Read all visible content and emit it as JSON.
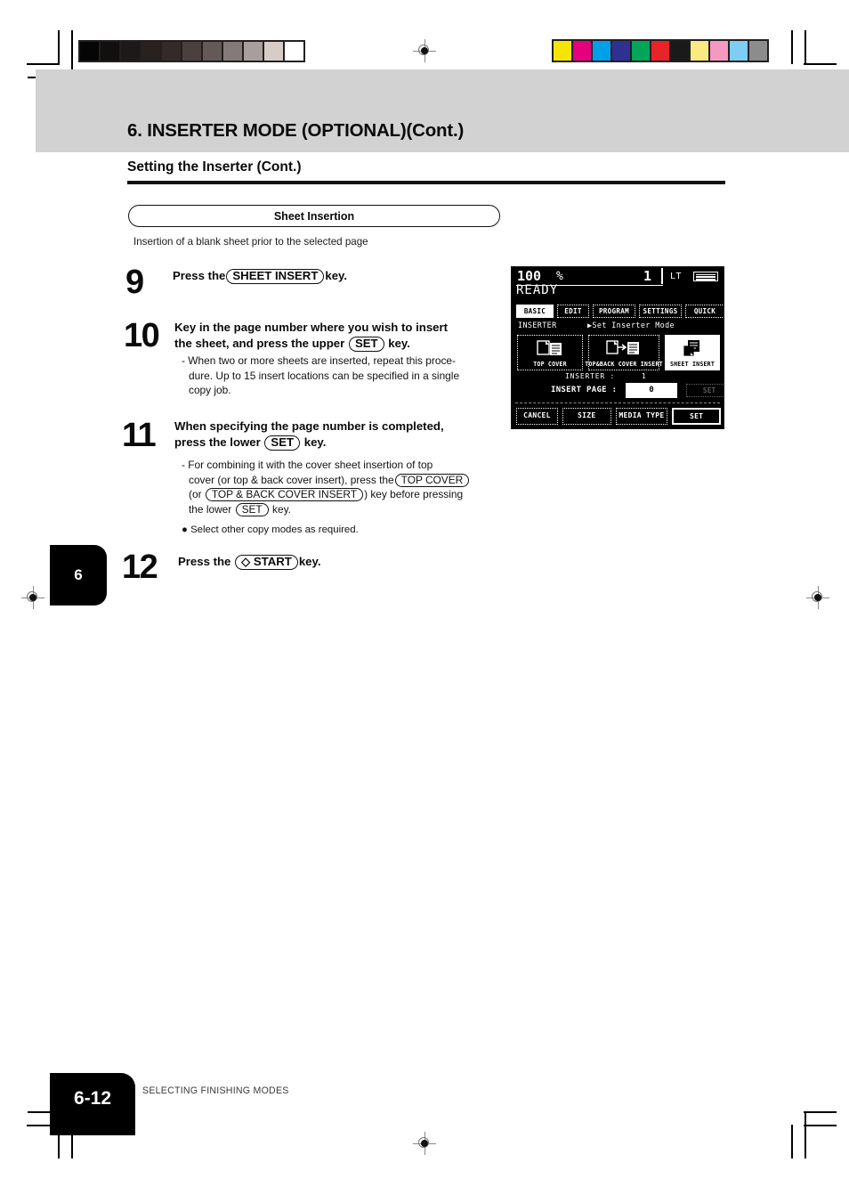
{
  "document": {
    "chapter_title": "6. INSERTER MODE (OPTIONAL)(Cont.)",
    "section_title": "Setting the Inserter (Cont.)",
    "pill_heading": "Sheet Insertion",
    "pill_subtext": "Insertion of a blank sheet prior to the selected page",
    "side_tab": "6",
    "folio": "6-12",
    "footer_text": "SELECTING FINISHING MODES"
  },
  "steps": [
    {
      "number": "9",
      "parts": [
        {
          "t": "text",
          "v": "Press the"
        },
        {
          "t": "key",
          "v": "SHEET INSERT"
        },
        {
          "t": "text",
          "v": "key."
        }
      ]
    },
    {
      "number": "10",
      "line1": "Key in the page number where you wish to insert",
      "line2_a": "the sheet, and press the upper",
      "key": "SET",
      "line2_b": "key.",
      "notes": [
        "- When two or more sheets are inserted, repeat  this proce-",
        "dure. Up to 15 insert locations can be specified in a single",
        "copy job."
      ]
    },
    {
      "number": "11",
      "line1": "When specifying the page number is completed,",
      "line2_a": "press the  lower",
      "key": "SET",
      "line2_b": "key.",
      "note_l1": "- For combining it with the cover sheet insertion of top",
      "note_l2_a": "cover (or top & back cover insert), press the",
      "note_key1": "TOP COVER",
      "note_l3_a": "(or",
      "note_key2": "TOP & BACK COVER INSERT",
      "note_l3_b": ") key before pressing",
      "note_l4_a": "the lower",
      "note_key3": "SET",
      "note_l4_b": "key.",
      "bullet": "Select other copy modes as required."
    },
    {
      "number": "12",
      "parts": [
        {
          "t": "text",
          "v": "Press the"
        },
        {
          "t": "key",
          "v": "◇ START"
        },
        {
          "t": "text",
          "v": "key."
        }
      ]
    }
  ],
  "lcd": {
    "zoom_ratio": "100",
    "percent_sign": "%",
    "copy_count": "1",
    "paper_size": "LT",
    "status": "READY",
    "tabs": [
      {
        "label": "BASIC",
        "active": true
      },
      {
        "label": "EDIT",
        "active": false
      },
      {
        "label": "PROGRAM",
        "active": false
      },
      {
        "label": "SETTINGS",
        "active": false
      },
      {
        "label": "QUICK",
        "active": false
      }
    ],
    "mode_label": "INSERTER",
    "mode_prompt": "▶Set Inserter Mode",
    "modes": [
      {
        "label": "TOP COVER",
        "selected": false
      },
      {
        "label": "TOP&BACK COVER INSERT",
        "selected": false
      },
      {
        "label": "SHEET INSERT",
        "selected": true
      }
    ],
    "inserter_row_label": "INSERTER  :",
    "inserter_row_value": "1",
    "insert_page_label": "INSERT PAGE  :",
    "insert_page_value": "0",
    "set_inline_label": "SET",
    "buttons": [
      {
        "label": "CANCEL",
        "emphasis": false
      },
      {
        "label": "SIZE",
        "emphasis": false
      },
      {
        "label": "MEDIA TYPE",
        "emphasis": false
      },
      {
        "label": "SET",
        "emphasis": true
      }
    ]
  },
  "print_marks": {
    "grayscale_bar": [
      "#050505",
      "#120f0f",
      "#1d1919",
      "#272120",
      "#332b29",
      "#4a413f",
      "#635957",
      "#837b79",
      "#a79f9d",
      "#d6cdc9",
      "#ffffff"
    ],
    "color_bar": [
      "#f6e500",
      "#e6007e",
      "#00a0e9",
      "#2e3192",
      "#00a65a",
      "#e8232a",
      "#1a1a1a",
      "#faea82",
      "#f49ac1",
      "#7ecdf2",
      "#8c8c8c"
    ]
  }
}
